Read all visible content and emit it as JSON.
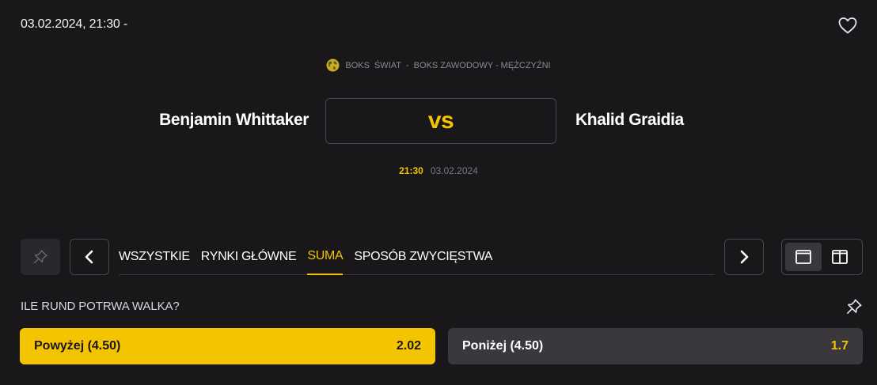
{
  "event": {
    "datetime_label": "03.02.2024, 21:30  -",
    "favorite_icon": "heart-outline-icon",
    "league": {
      "icon": "globe-icon",
      "sport": "BOKS",
      "region": "ŚWIAT",
      "sep": "-",
      "competition": "BOKS ZAWODOWY - MĘŻCZYŹNI"
    },
    "home": "Benjamin Whittaker",
    "vs": "vs",
    "away": "Khalid Graidia",
    "time": "21:30",
    "date": "03.02.2024"
  },
  "toolbar": {
    "pin_icon": "pin-icon",
    "prev_icon": "chevron-left-icon",
    "next_icon": "chevron-right-icon",
    "tabs": [
      {
        "label": "WSZYSTKIE",
        "active": false
      },
      {
        "label": "RYNKI GŁÓWNE",
        "active": false
      },
      {
        "label": "SUMA",
        "active": true
      },
      {
        "label": "SPOSÓB ZWYCIĘSTWA",
        "active": false
      }
    ],
    "views": [
      {
        "icon": "single-column-icon",
        "active": true
      },
      {
        "icon": "two-columns-icon",
        "active": false
      }
    ]
  },
  "market": {
    "title": "ILE RUND POTRWA WALKA?",
    "pin_icon": "pin-icon",
    "outcomes": [
      {
        "label": "Powyżej (4.50)",
        "price": "2.02",
        "selected": true
      },
      {
        "label": "Poniżej (4.50)",
        "price": "1.7",
        "selected": false
      }
    ]
  },
  "colors": {
    "background": "#19171a",
    "accent": "#f5c400",
    "button_dark": "#3a383c",
    "border": "#4a484c"
  }
}
